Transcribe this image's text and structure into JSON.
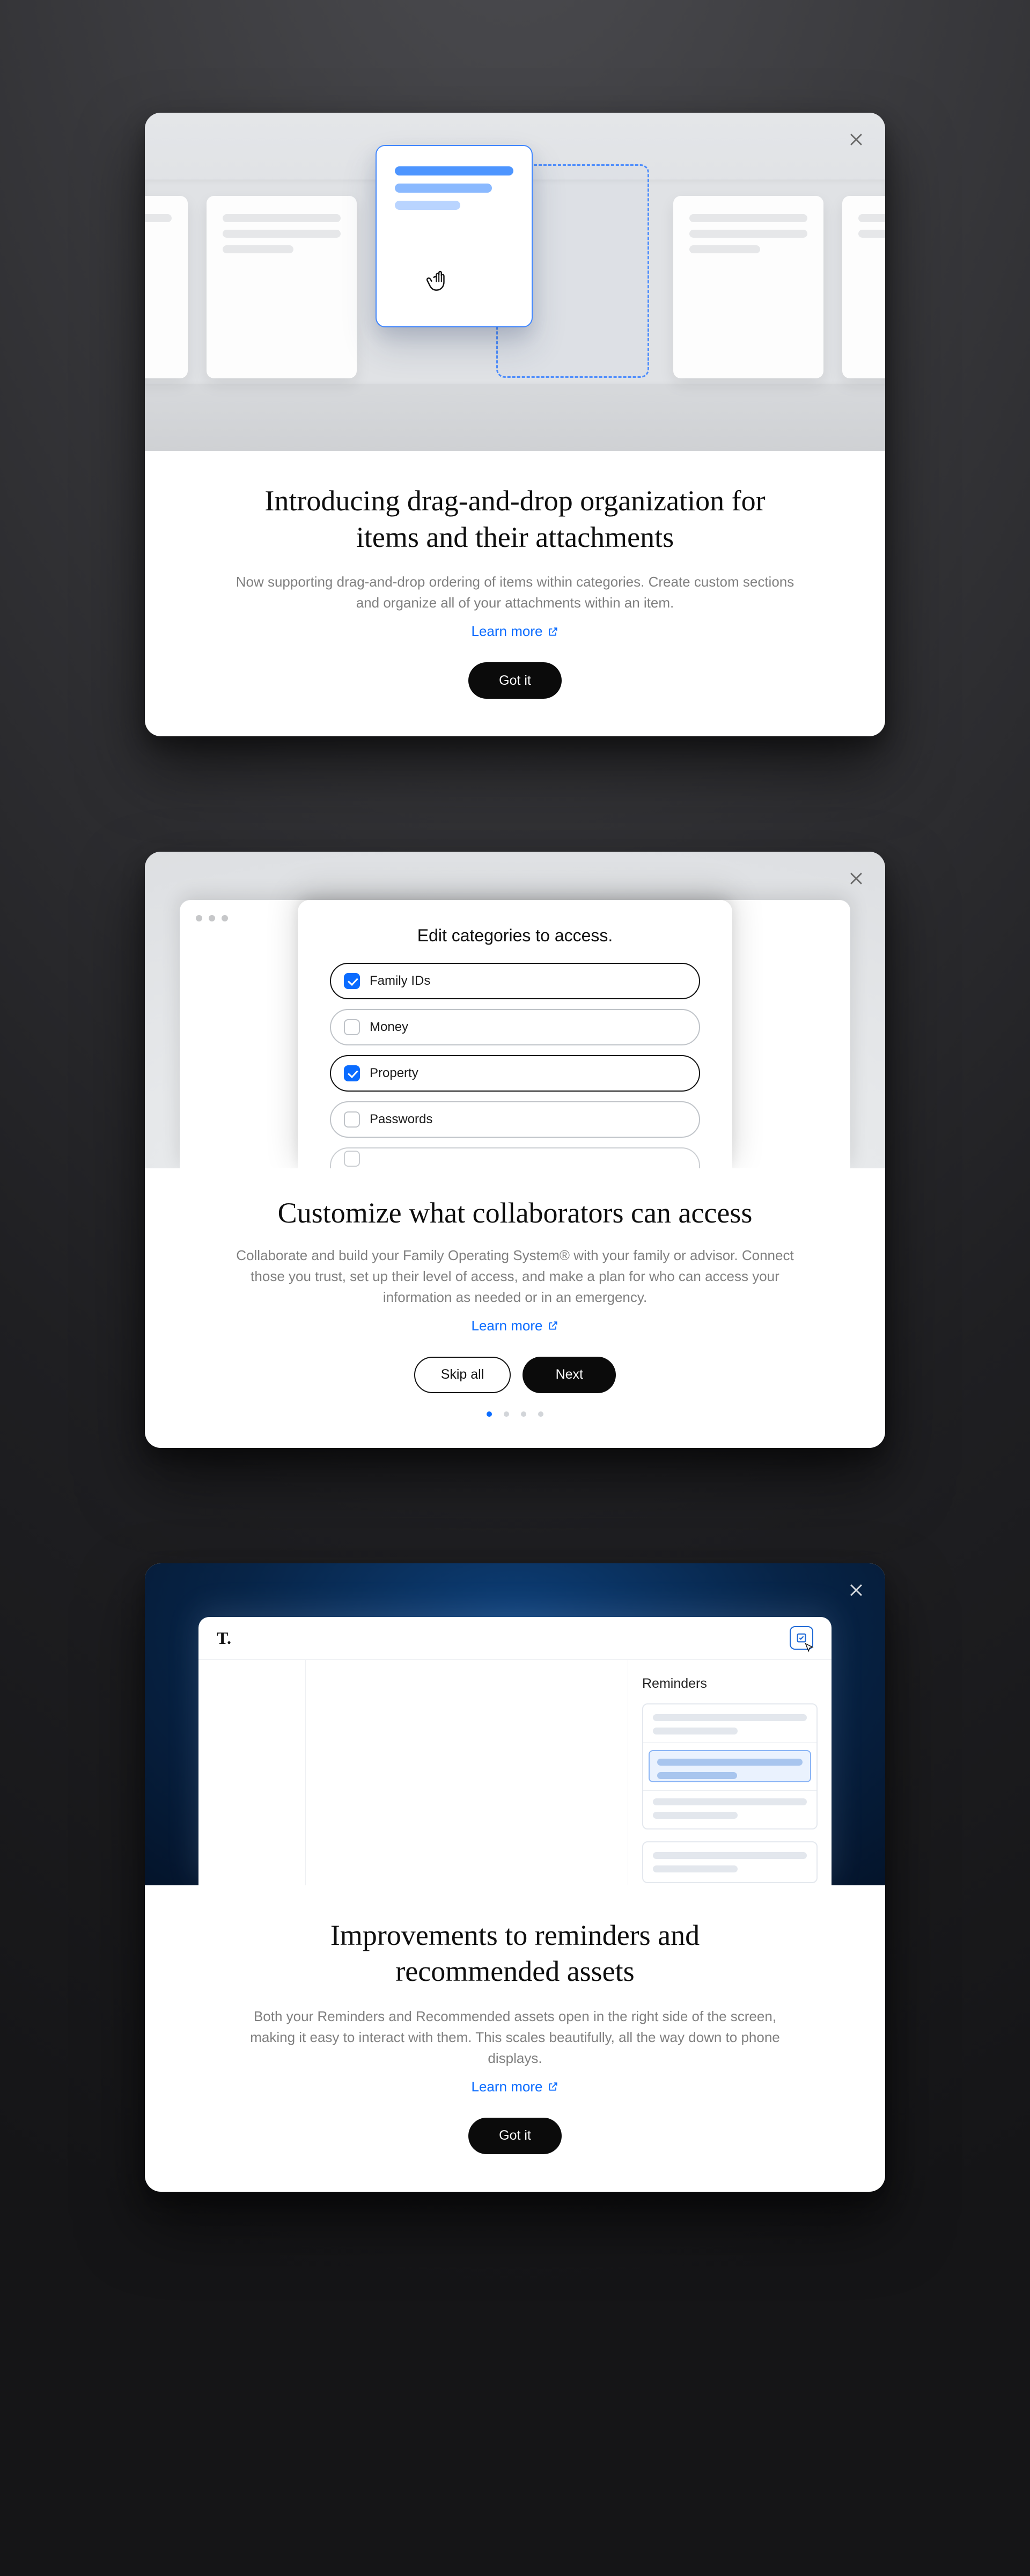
{
  "modal1": {
    "title": "Introducing drag‑and‑drop organization for items and their attachments",
    "desc": "Now supporting drag‑and‑drop ordering of items within categories. Create custom sections and organize all of your attachments within an item.",
    "learn": "Learn more",
    "cta": "Got it"
  },
  "modal2": {
    "panel_title": "Edit categories to access.",
    "categories": [
      {
        "label": "Family IDs",
        "selected": true
      },
      {
        "label": "Money",
        "selected": false
      },
      {
        "label": "Property",
        "selected": true
      },
      {
        "label": "Passwords",
        "selected": false
      }
    ],
    "title": "Customize what collaborators can access",
    "desc": "Collaborate and build your Family Operating System® with your family or advisor. Connect those you trust, set up their level of access, and make a plan for who can access your information as needed or in an emergency.",
    "learn": "Learn more",
    "skip": "Skip all",
    "next": "Next",
    "page_index": 0,
    "page_count": 4
  },
  "modal3": {
    "brand": "T.",
    "panel_title": "Reminders",
    "title": "Improvements to reminders and recommended assets",
    "desc": "Both your Reminders and Recommended assets open in the right side of the screen, making it easy to interact with them. This scales beautifully, all the way down to phone displays.",
    "learn": "Learn more",
    "cta": "Got it"
  }
}
